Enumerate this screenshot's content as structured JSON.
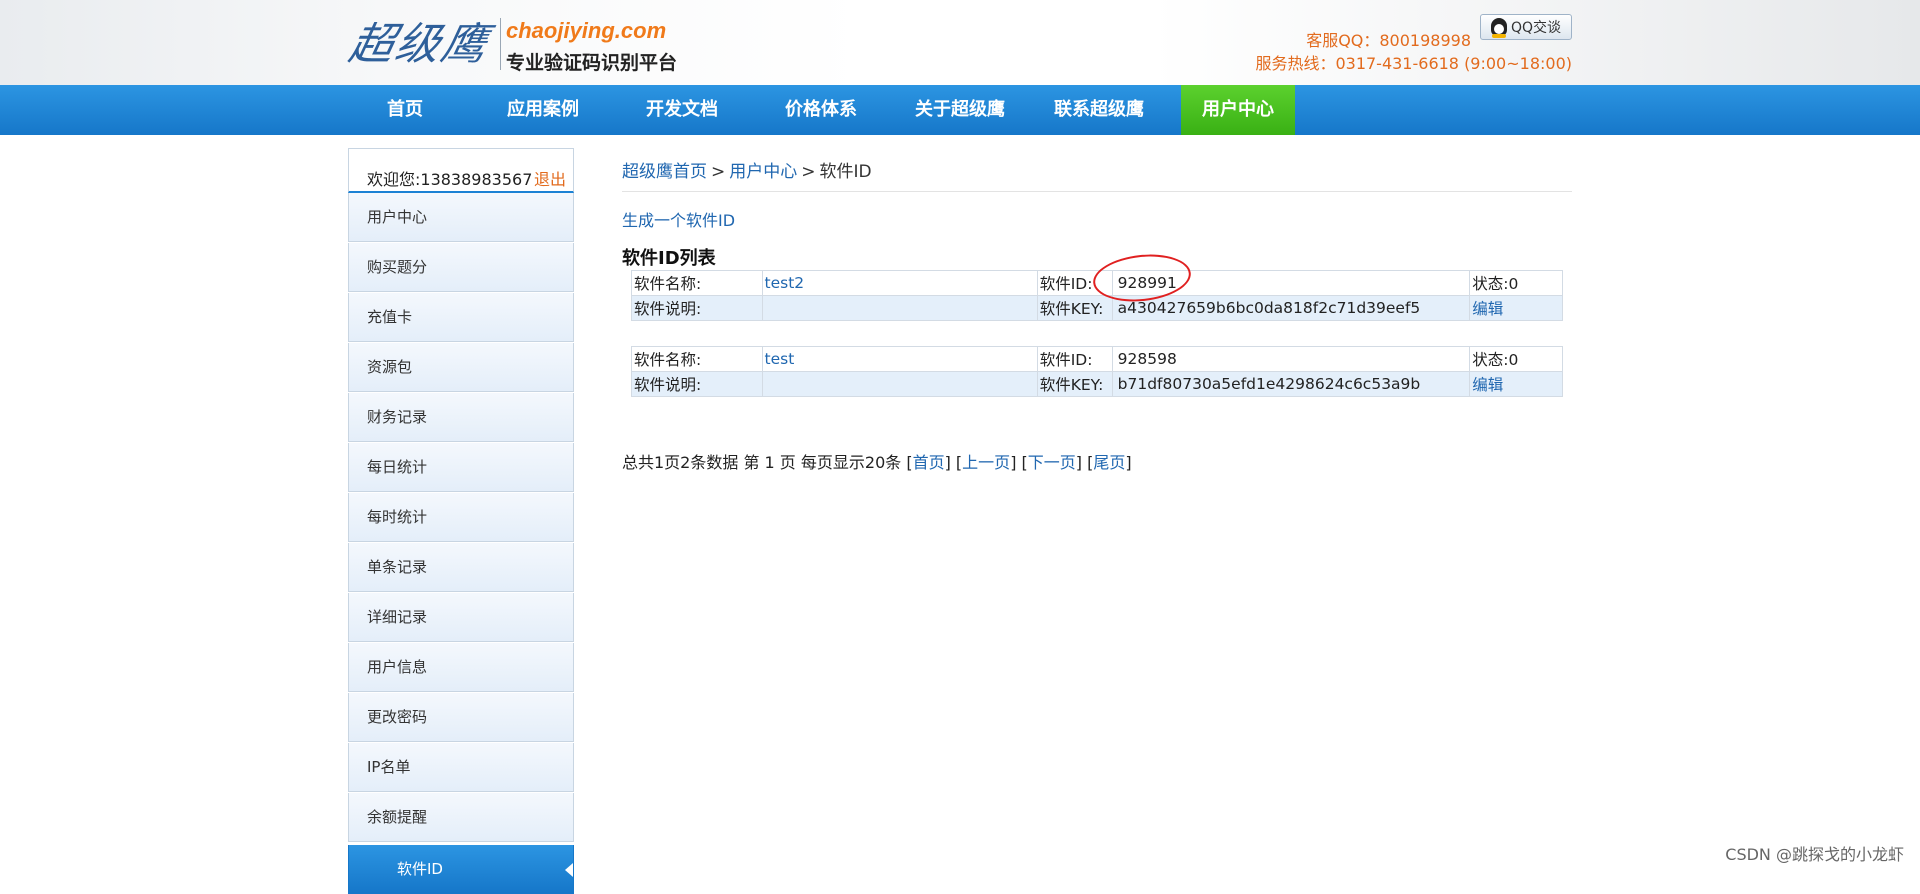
{
  "header": {
    "logo_text": "超级鹰",
    "logo_domain": "chaojiying.com",
    "logo_slogan": "专业验证码识别平台",
    "service_qq": "客服QQ：800198998",
    "service_hotline": "服务热线：0317-431-6618 (9:00~18:00)",
    "qq_chat_label": "QQ交谈"
  },
  "nav": {
    "items": [
      {
        "label": "首页"
      },
      {
        "label": "应用案例"
      },
      {
        "label": "开发文档"
      },
      {
        "label": "价格体系"
      },
      {
        "label": "关于超级鹰"
      },
      {
        "label": "联系超级鹰"
      },
      {
        "label": "用户中心"
      }
    ],
    "active_label": "用户中心"
  },
  "sidebar": {
    "welcome": "欢迎您:13838983567",
    "logout": "退出",
    "items": [
      {
        "label": "用户中心"
      },
      {
        "label": "购买题分"
      },
      {
        "label": "充值卡"
      },
      {
        "label": "资源包"
      },
      {
        "label": "财务记录"
      },
      {
        "label": "每日统计"
      },
      {
        "label": "每时统计"
      },
      {
        "label": "单条记录"
      },
      {
        "label": "详细记录"
      },
      {
        "label": "用户信息"
      },
      {
        "label": "更改密码"
      },
      {
        "label": "IP名单"
      },
      {
        "label": "余额提醒"
      },
      {
        "label": "软件ID"
      }
    ],
    "active_label": "软件ID"
  },
  "breadcrumb": {
    "home": "超级鹰首页",
    "sep1": ">",
    "user_center": "用户中心",
    "sep2": ">",
    "current": "软件ID"
  },
  "main": {
    "generate_link": "生成一个软件ID",
    "list_title": "软件ID列表",
    "labels": {
      "name": "软件名称:",
      "id": "软件ID:",
      "desc": "软件说明:",
      "key": "软件KEY:",
      "edit": "编辑"
    },
    "software": [
      {
        "name": "test2",
        "id": "928991",
        "status": "状态:0",
        "desc": "",
        "key": "a430427659b6bc0da818f2c71d39eef5"
      },
      {
        "name": "test",
        "id": "928598",
        "status": "状态:0",
        "desc": "",
        "key": "b71df80730a5efd1e4298624c6c53a9b"
      }
    ],
    "pager": {
      "summary": "总共1页2条数据 第 1 页 每页显示20条",
      "first": "首页",
      "prev": "上一页",
      "next": "下一页",
      "last": "尾页"
    }
  },
  "watermark": "CSDN @跳探戈的小龙虾",
  "colors": {
    "nav_blue": "#1e88d8",
    "nav_active_green": "#46c11f",
    "link_blue": "#2067b0",
    "orange": "#e26b1e",
    "annotation_red": "#e02020"
  }
}
